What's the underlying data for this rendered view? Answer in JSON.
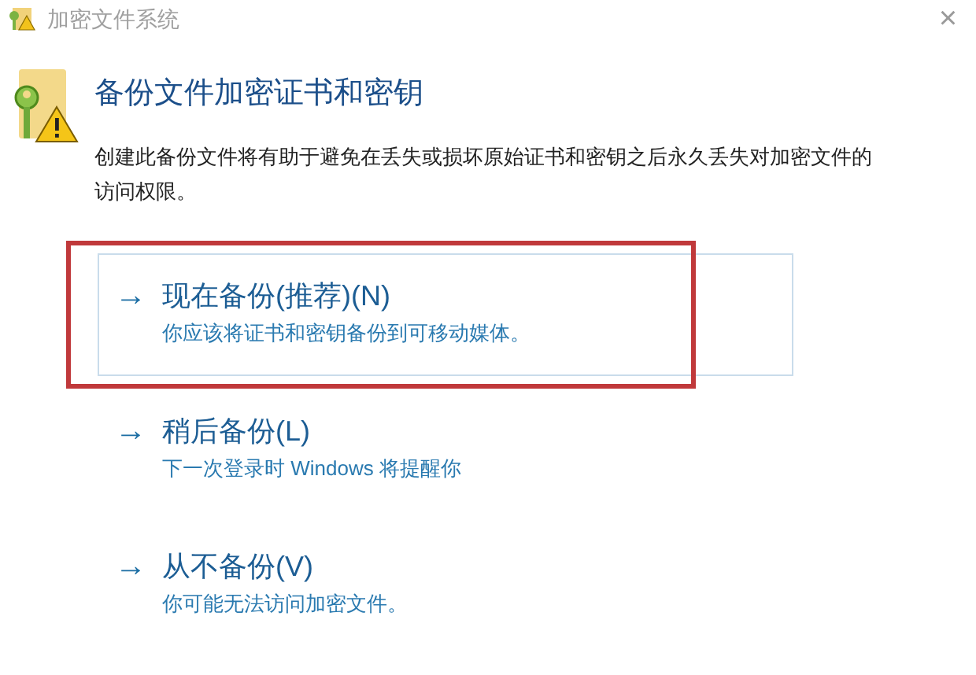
{
  "window": {
    "title": "加密文件系统",
    "close": "×"
  },
  "heading": "备份文件加密证书和密钥",
  "description": "创建此备份文件将有助于避免在丢失或损坏原始证书和密钥之后永久丢失对加密文件的访问权限。",
  "options": [
    {
      "arrow": "→",
      "label": "现在备份(推荐)(N)",
      "detail": "你应该将证书和密钥备份到可移动媒体。",
      "selected": true,
      "annotated": true
    },
    {
      "arrow": "→",
      "label": "稍后备份(L)",
      "detail": "下一次登录时 Windows 将提醒你",
      "selected": false,
      "annotated": false
    },
    {
      "arrow": "→",
      "label": "从不备份(V)",
      "detail": "你可能无法访问加密文件。",
      "selected": false,
      "annotated": false
    }
  ]
}
